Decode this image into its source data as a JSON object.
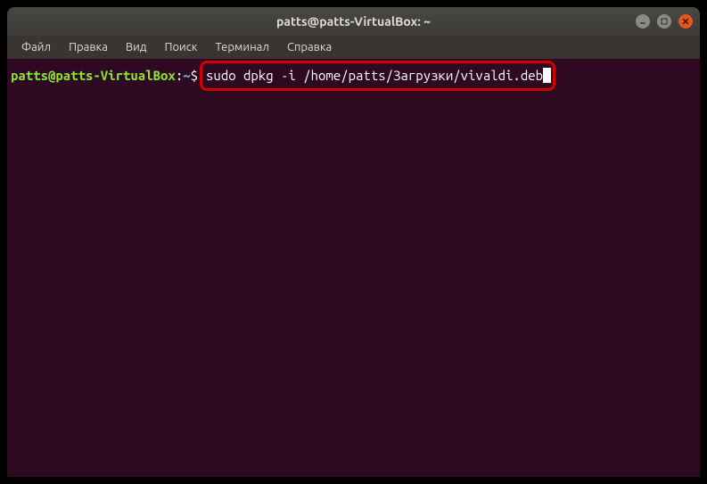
{
  "window": {
    "title": "patts@patts-VirtualBox: ~"
  },
  "menubar": {
    "items": [
      "Файл",
      "Правка",
      "Вид",
      "Поиск",
      "Терминал",
      "Справка"
    ]
  },
  "terminal": {
    "prompt": {
      "user_host": "patts@patts-VirtualBox",
      "colon": ":",
      "path": "~",
      "symbol": "$"
    },
    "command": "sudo dpkg -i /home/patts/Загрузки/vivaldi.deb"
  }
}
